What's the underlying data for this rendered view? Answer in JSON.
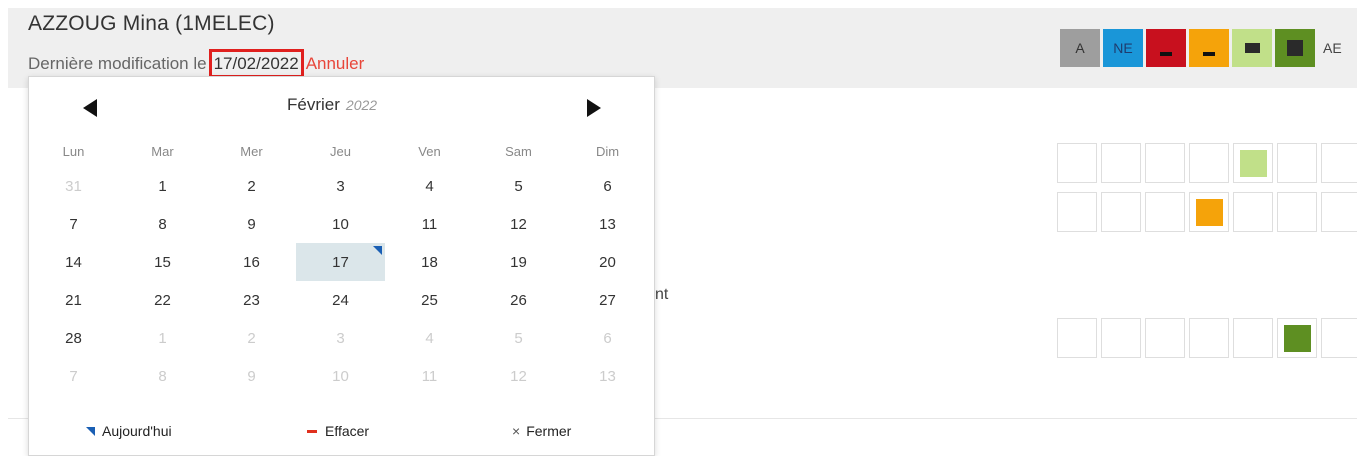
{
  "header": {
    "student_name": "AZZOUG Mina (1MELEC)",
    "modif_label": "Dernière modification le",
    "modif_date": "17/02/2022",
    "cancel_label": "Annuler"
  },
  "legend": {
    "items": [
      {
        "label": "A",
        "color": "#9e9e9e",
        "icon": "text"
      },
      {
        "label": "NE",
        "color": "#1a96d8",
        "icon": "text"
      },
      {
        "label": "",
        "color": "#c8101e",
        "icon": "dash-icon"
      },
      {
        "label": "",
        "color": "#f5a30a",
        "icon": "dash-icon"
      },
      {
        "label": "",
        "color": "#c1e089",
        "icon": "small-square-icon"
      },
      {
        "label": "",
        "color": "#5e8f22",
        "icon": "square-icon"
      }
    ],
    "ae_label": "AE"
  },
  "grid_rows": [
    {
      "filled_index": 4,
      "fill_color": "#c1e089"
    },
    {
      "filled_index": 3,
      "fill_color": "#f5a30a"
    },
    {
      "filled_index": 5,
      "fill_color": "#5e8f22"
    }
  ],
  "background_fragment": "nt",
  "calendar": {
    "month": "Février",
    "year": "2022",
    "weekdays": [
      "Lun",
      "Mar",
      "Mer",
      "Jeu",
      "Ven",
      "Sam",
      "Dim"
    ],
    "weeks": [
      [
        "31",
        "1",
        "2",
        "3",
        "4",
        "5",
        "6"
      ],
      [
        "7",
        "8",
        "9",
        "10",
        "11",
        "12",
        "13"
      ],
      [
        "14",
        "15",
        "16",
        "17",
        "18",
        "19",
        "20"
      ],
      [
        "21",
        "22",
        "23",
        "24",
        "25",
        "26",
        "27"
      ],
      [
        "28",
        "1",
        "2",
        "3",
        "4",
        "5",
        "6"
      ],
      [
        "7",
        "8",
        "9",
        "10",
        "11",
        "12",
        "13"
      ]
    ],
    "selected_day": "17",
    "today_day": "17",
    "footer": {
      "today_label": "Aujourd'hui",
      "clear_label": "Effacer",
      "close_label": "Fermer",
      "close_icon": "×"
    }
  }
}
